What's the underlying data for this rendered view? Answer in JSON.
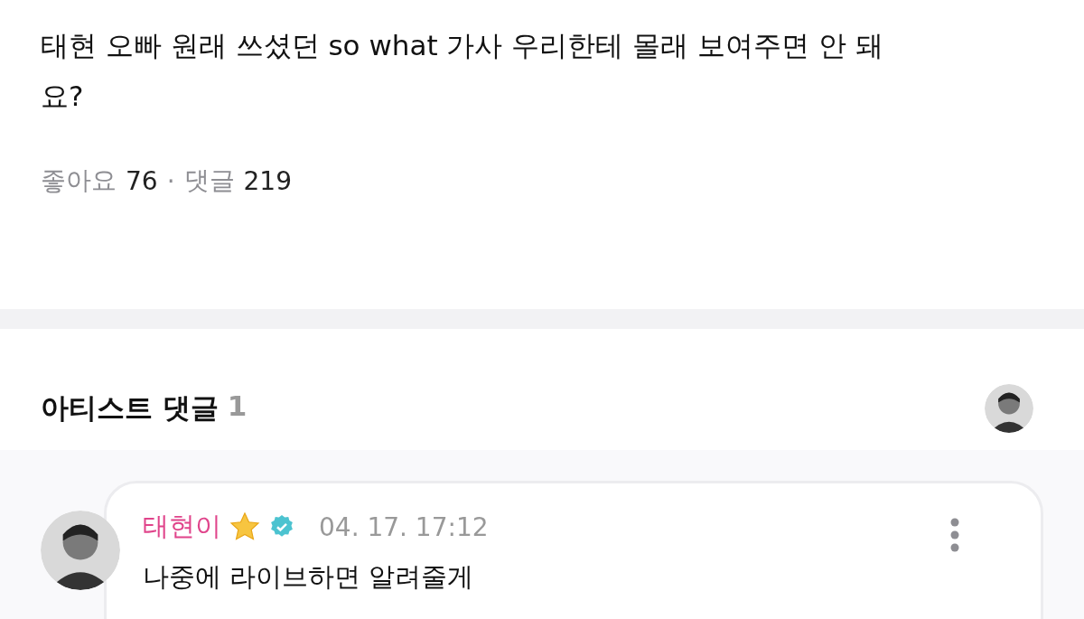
{
  "post": {
    "text": "태현 오빠 원래 쓰셨던 so what 가사 우리한테 몰래 보여주면 안 돼요?",
    "likes_label": "좋아요",
    "likes_count": "76",
    "separator": "·",
    "comments_label": "댓글",
    "comments_count": "219"
  },
  "artist_comments": {
    "title": "아티스트 댓글",
    "count": "1"
  },
  "comments": [
    {
      "author": "태현이",
      "verified": true,
      "time": "04. 17. 17:12",
      "text": "나중에 라이브하면 알려줄게"
    }
  ]
}
